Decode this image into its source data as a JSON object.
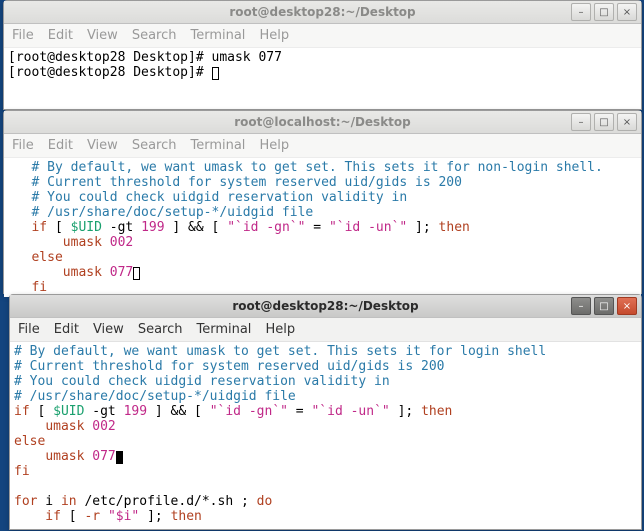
{
  "menus": {
    "file": "File",
    "edit": "Edit",
    "view": "View",
    "search": "Search",
    "terminal": "Terminal",
    "help": "Help"
  },
  "icons": {
    "minimize": "–",
    "maximize": "□",
    "close": "×"
  },
  "win1": {
    "title": "root@desktop28:~/Desktop",
    "lines": {
      "l1a": "[root@desktop28 Desktop]# ",
      "l1b": "umask 077",
      "l2a": "[root@desktop28 Desktop]# "
    }
  },
  "win2": {
    "title": "root@localhost:~/Desktop",
    "lines": {
      "c1": "   # By default, we want umask to get set. This sets it for non-login shell.",
      "c2": "   # Current threshold for system reserved uid/gids is 200",
      "c3": "   # You could check uidgid reservation validity in",
      "c4": "   # /usr/share/doc/setup-*/uidgid file",
      "if1a": "   if",
      "if1b": " [ ",
      "if1c": "$UID",
      "if1d": " -gt ",
      "if1e": "199",
      "if1f": " ] && [ ",
      "if1g": "\"`id -gn`\"",
      "if1h": " = ",
      "if1i": "\"`id -un`\"",
      "if1j": " ]; ",
      "if1k": "then",
      "um1a": "       ",
      "um1b": "umask ",
      "um1c": "002",
      "else": "   else",
      "um2a": "       ",
      "um2b": "umask ",
      "um2c": "077",
      "fi": "   fi"
    }
  },
  "win3": {
    "title": "root@desktop28:~/Desktop",
    "lines": {
      "c1": "# By default, we want umask to get set. This sets it for login shell",
      "c2": "# Current threshold for system reserved uid/gids is 200",
      "c3": "# You could check uidgid reservation validity in",
      "c4": "# /usr/share/doc/setup-*/uidgid file",
      "if1a": "if",
      "if1b": " [ ",
      "if1c": "$UID",
      "if1d": " -gt ",
      "if1e": "199",
      "if1f": " ] && [ ",
      "if1g": "\"`id -gn`\"",
      "if1h": " = ",
      "if1i": "\"`id -un`\"",
      "if1j": " ]; ",
      "if1k": "then",
      "um1a": "    ",
      "um1b": "umask ",
      "um1c": "002",
      "else": "else",
      "um2a": "    ",
      "um2b": "umask ",
      "um2c": "077",
      "fi": "fi",
      "blank": "",
      "for1a": "for",
      "for1b": " i ",
      "for1c": "in",
      "for1d": " /etc/profile.d/*.sh ; ",
      "for1e": "do",
      "if2a": "    if",
      "if2b": " [ ",
      "if2c": "-r",
      "if2d": " ",
      "if2e": "\"$i\"",
      "if2f": " ]; ",
      "if2g": "then"
    }
  }
}
